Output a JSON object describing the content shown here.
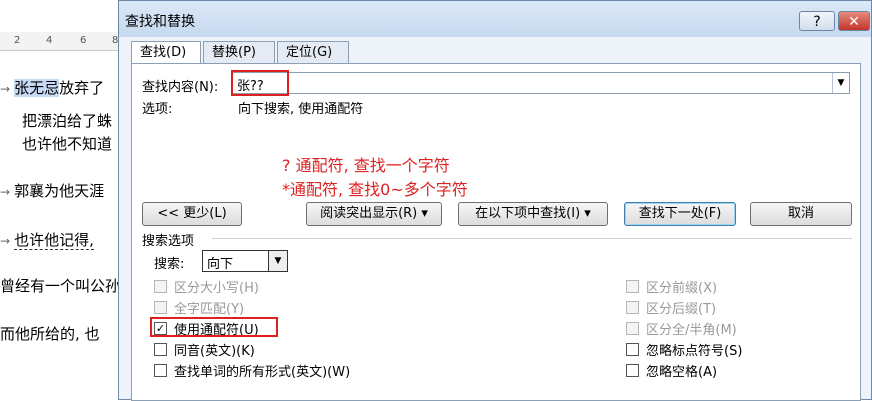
{
  "document": {
    "ruler": [
      "2",
      "4",
      "6",
      "8"
    ],
    "lines": [
      {
        "prefix": "→",
        "highlight": "张无忌",
        "text": "放弃了"
      },
      {
        "prefix": "",
        "highlight": "",
        "text": "把漂泊给了蛛"
      },
      {
        "prefix": "",
        "highlight": "",
        "text": "也许他不知道"
      },
      {
        "prefix": "→",
        "highlight": "",
        "text": "郭襄为他天涯"
      },
      {
        "prefix": "→",
        "highlight": "",
        "text": "也许他记得,"
      },
      {
        "prefix": "",
        "highlight": "",
        "text": "曾经有一个叫公孙"
      },
      {
        "prefix": "",
        "highlight": "",
        "text": "而他所给的, 也"
      }
    ]
  },
  "dialog": {
    "title": "查找和替换",
    "help_label": "?",
    "close_label": "✕",
    "tabs": [
      "查找(D)",
      "替换(P)",
      "定位(G)"
    ],
    "find_label": "查找内容(N):",
    "find_value": "张??",
    "options_label": "选项:",
    "options_value": "向下搜索, 使用通配符",
    "notes": [
      "? 通配符, 查找一个字符",
      "*通配符, 查找0~多个字符"
    ],
    "buttons": {
      "less": "<< 更少(L)",
      "reading_highlight": "阅读突出显示(R) ▾",
      "find_in": "在以下项中查找(I) ▾",
      "find_next": "查找下一处(F)",
      "cancel": "取消"
    },
    "search_options_label": "搜索选项",
    "search_label": "搜索:",
    "search_value": "向下",
    "left_options": [
      {
        "label": "区分大小写(H)",
        "checked": false,
        "enabled": false
      },
      {
        "label": "全字匹配(Y)",
        "checked": false,
        "enabled": false
      },
      {
        "label": "使用通配符(U)",
        "checked": true,
        "enabled": true
      },
      {
        "label": "同音(英文)(K)",
        "checked": false,
        "enabled": true
      },
      {
        "label": "查找单词的所有形式(英文)(W)",
        "checked": false,
        "enabled": true
      }
    ],
    "right_options": [
      {
        "label": "区分前缀(X)",
        "checked": false,
        "enabled": false
      },
      {
        "label": "区分后缀(T)",
        "checked": false,
        "enabled": false
      },
      {
        "label": "区分全/半角(M)",
        "checked": false,
        "enabled": false
      },
      {
        "label": "忽略标点符号(S)",
        "checked": false,
        "enabled": true
      },
      {
        "label": "忽略空格(A)",
        "checked": false,
        "enabled": true
      }
    ]
  }
}
